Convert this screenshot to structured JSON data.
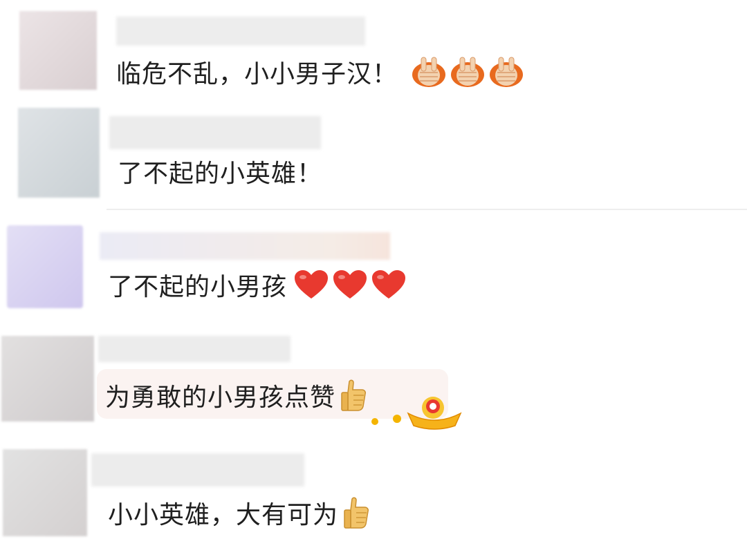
{
  "comments": [
    {
      "text": "临危不乱，小小男子汉！",
      "emoji": "hands-shaking-icon",
      "emoji_count": 3
    },
    {
      "text": "了不起的小英雄！"
    },
    {
      "text": "了不起的小男孩",
      "emoji": "red-heart-icon",
      "emoji_count": 3
    },
    {
      "text": "为勇敢的小男孩点赞",
      "emoji": "thumbs-up-icon",
      "emoji_count": 1
    },
    {
      "text": "小小英雄，大有可为",
      "emoji": "thumbs-up-icon",
      "emoji_count": 1
    }
  ],
  "colors": {
    "text": "#1f1f1f",
    "heart": "#e8392f",
    "bubble": "#fbf3f1",
    "emoji_orange": "#e86a1f"
  }
}
